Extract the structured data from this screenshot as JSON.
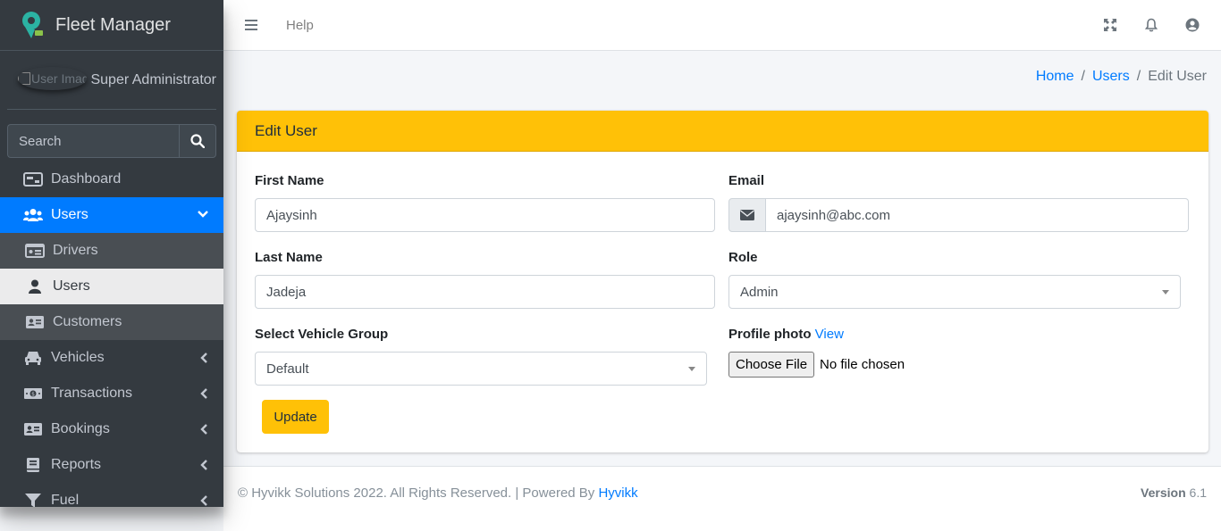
{
  "brand": {
    "name": "Fleet Manager"
  },
  "user_panel": {
    "image_alt": "User Image",
    "name": "Super Administrator"
  },
  "search": {
    "placeholder": "Search"
  },
  "sidebar": {
    "items": [
      {
        "label": "Dashboard",
        "icon": "dashboard-icon"
      },
      {
        "label": "Users",
        "icon": "users-icon",
        "active": true
      },
      {
        "label": "Drivers",
        "icon": "id-card-icon",
        "sub": true
      },
      {
        "label": "Users",
        "icon": "user-icon",
        "sub": true,
        "current": true
      },
      {
        "label": "Customers",
        "icon": "address-card-icon",
        "sub": true
      },
      {
        "label": "Vehicles",
        "icon": "car-icon"
      },
      {
        "label": "Transactions",
        "icon": "money-icon"
      },
      {
        "label": "Bookings",
        "icon": "address-card-icon"
      },
      {
        "label": "Reports",
        "icon": "book-icon"
      },
      {
        "label": "Fuel",
        "icon": "filter-icon"
      }
    ]
  },
  "topbar": {
    "help": "Help"
  },
  "breadcrumb": {
    "home": "Home",
    "users": "Users",
    "current": "Edit User",
    "sep": "/"
  },
  "card": {
    "title": "Edit User",
    "first_name_label": "First Name",
    "first_name_value": "Ajaysinh",
    "last_name_label": "Last Name",
    "last_name_value": "Jadeja",
    "email_label": "Email",
    "email_value": "ajaysinh@abc.com",
    "role_label": "Role",
    "role_value": "Admin",
    "vehicle_group_label": "Select Vehicle Group",
    "vehicle_group_value": "Default",
    "profile_photo_label": "Profile photo",
    "profile_photo_link": "View",
    "file_button": "Choose File",
    "file_status": "No file chosen",
    "update_button": "Update"
  },
  "footer": {
    "copyright": "© Hyvikk Solutions 2022. All Rights Reserved. | Powered By",
    "powered_link": "Hyvikk",
    "version_label": "Version",
    "version_value": "6.1"
  },
  "colors": {
    "accent": "#ffc107",
    "primary": "#007bff",
    "sidebar": "#343a40"
  }
}
